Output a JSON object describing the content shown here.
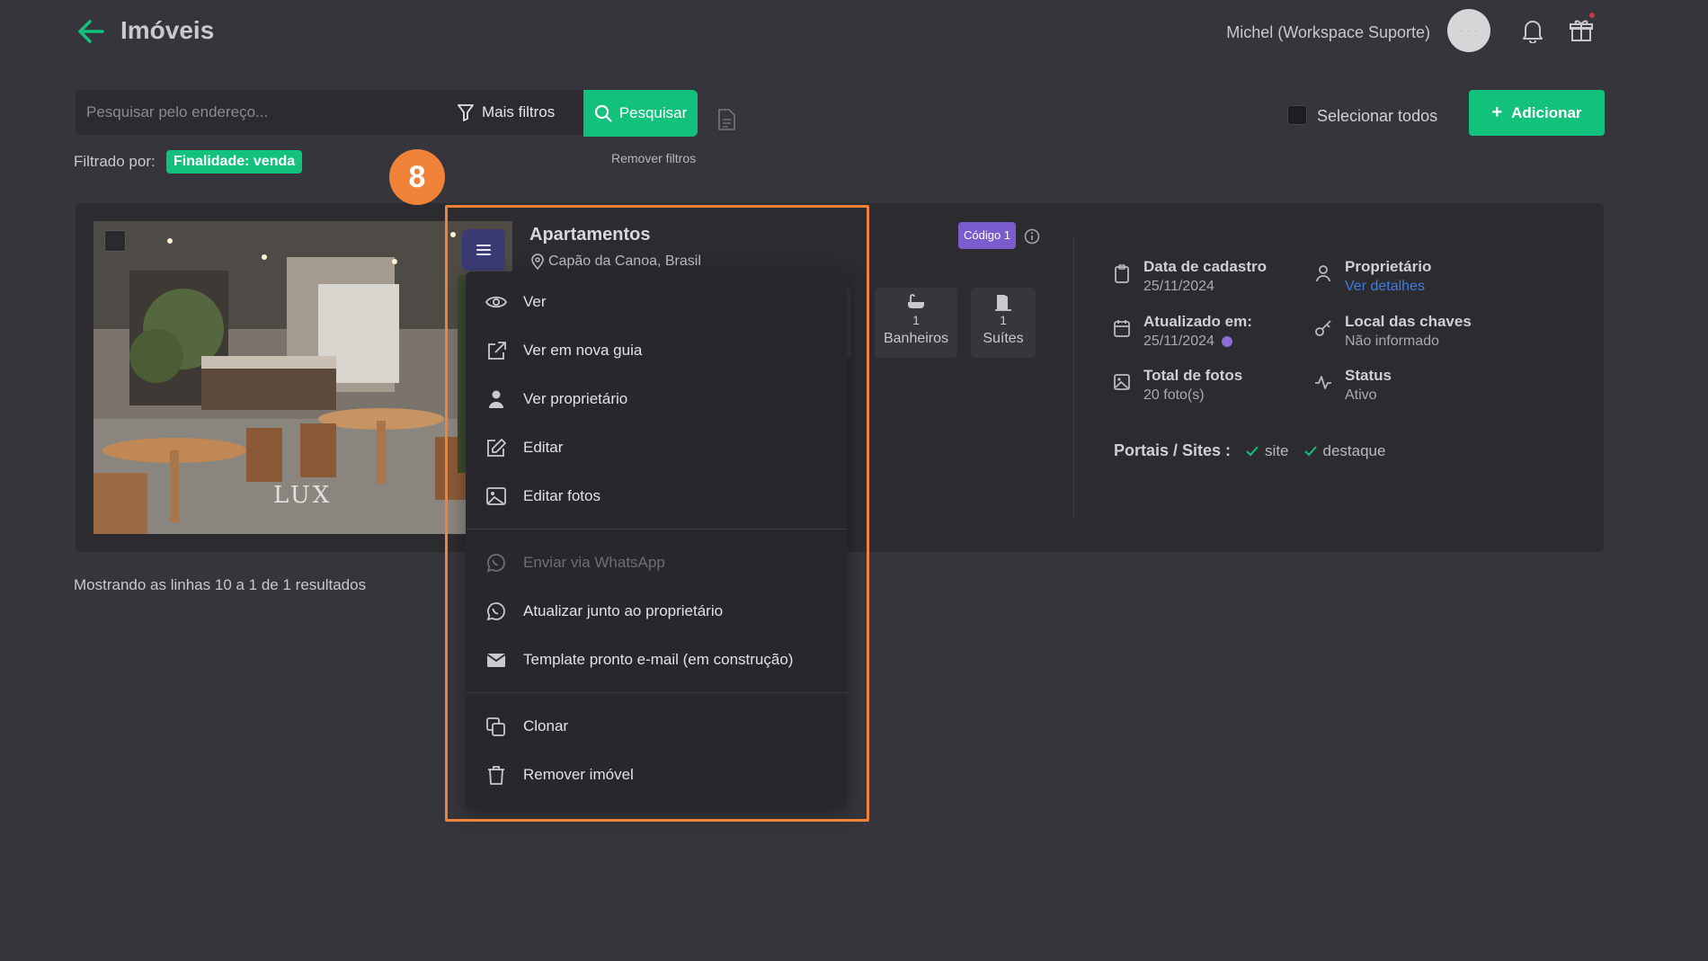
{
  "header": {
    "title": "Imóveis",
    "user_name": "Michel (Workspace Suporte)",
    "avatar_text": "· · ·"
  },
  "search": {
    "placeholder": "Pesquisar pelo endereço...",
    "more_filters": "Mais filtros",
    "search_button": "Pesquisar"
  },
  "filters": {
    "label": "Filtrado por:",
    "active_tag": "Finalidade: venda",
    "remove": "Remover filtros"
  },
  "toolbar": {
    "select_all": "Selecionar todos",
    "add_button": "Adicionar"
  },
  "property": {
    "title": "Apartamentos",
    "location": "Capão da Canoa, Brasil",
    "code_badge": "Código 1",
    "features": [
      {
        "icon": "bathtub-icon",
        "count": "1",
        "label": "Banheiros"
      },
      {
        "icon": "door-icon",
        "count": "1",
        "label": "Suítes"
      }
    ],
    "meta": {
      "created_label": "Data de cadastro",
      "created_value": "25/11/2024",
      "owner_label": "Proprietário",
      "owner_value": "Ver detalhes",
      "updated_label": "Atualizado em:",
      "updated_value": "25/11/2024",
      "keys_label": "Local das chaves",
      "keys_value": "Não informado",
      "photos_label": "Total de fotos",
      "photos_value": "20 foto(s)",
      "status_label": "Status",
      "status_value": "Ativo"
    },
    "portals_label": "Portais / Sites :",
    "portals": [
      "site",
      "destaque"
    ],
    "photo_watermark": "LUX"
  },
  "results_text": "Mostrando as linhas 10 a 1 de 1 resultados",
  "context_menu": {
    "items": [
      {
        "label": "Ver",
        "icon": "eye-icon",
        "disabled": false
      },
      {
        "label": "Ver em nova guia",
        "icon": "external-link-icon",
        "disabled": false
      },
      {
        "label": "Ver proprietário",
        "icon": "user-icon",
        "disabled": false
      },
      {
        "label": "Editar",
        "icon": "edit-icon",
        "disabled": false
      },
      {
        "label": "Editar fotos",
        "icon": "image-icon",
        "disabled": false
      },
      {
        "label": "Enviar via WhatsApp",
        "icon": "whatsapp-icon",
        "disabled": true
      },
      {
        "label": "Atualizar junto ao proprietário",
        "icon": "whatsapp-icon",
        "disabled": false
      },
      {
        "label": "Template pronto e-mail (em construção)",
        "icon": "mail-icon",
        "disabled": false
      },
      {
        "label": "Clonar",
        "icon": "copy-icon",
        "disabled": false
      },
      {
        "label": "Remover imóvel",
        "icon": "trash-icon",
        "disabled": false
      }
    ]
  },
  "annotation": {
    "step_number": "8",
    "color": "#f0823a"
  },
  "colors": {
    "accent": "#12c17c",
    "background": "#35353b",
    "panel": "#2b2b30",
    "badge_purple": "#7a5ccf",
    "link_blue": "#3f7be0"
  }
}
